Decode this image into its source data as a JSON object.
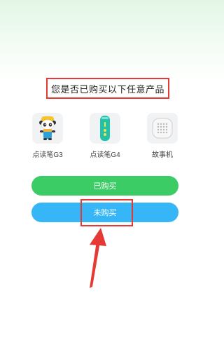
{
  "question": "您是否已购买以下任意产品",
  "products": [
    {
      "label": "点读笔G3",
      "icon": "panda-pen-icon"
    },
    {
      "label": "点读笔G4",
      "icon": "teal-pen-icon"
    },
    {
      "label": "故事机",
      "icon": "story-machine-icon"
    }
  ],
  "buttons": {
    "bought_label": "已购买",
    "not_bought_label": "未购买"
  },
  "colors": {
    "bought": "#3ccc66",
    "not_bought": "#36b6f7",
    "annotation": "#e53935"
  }
}
